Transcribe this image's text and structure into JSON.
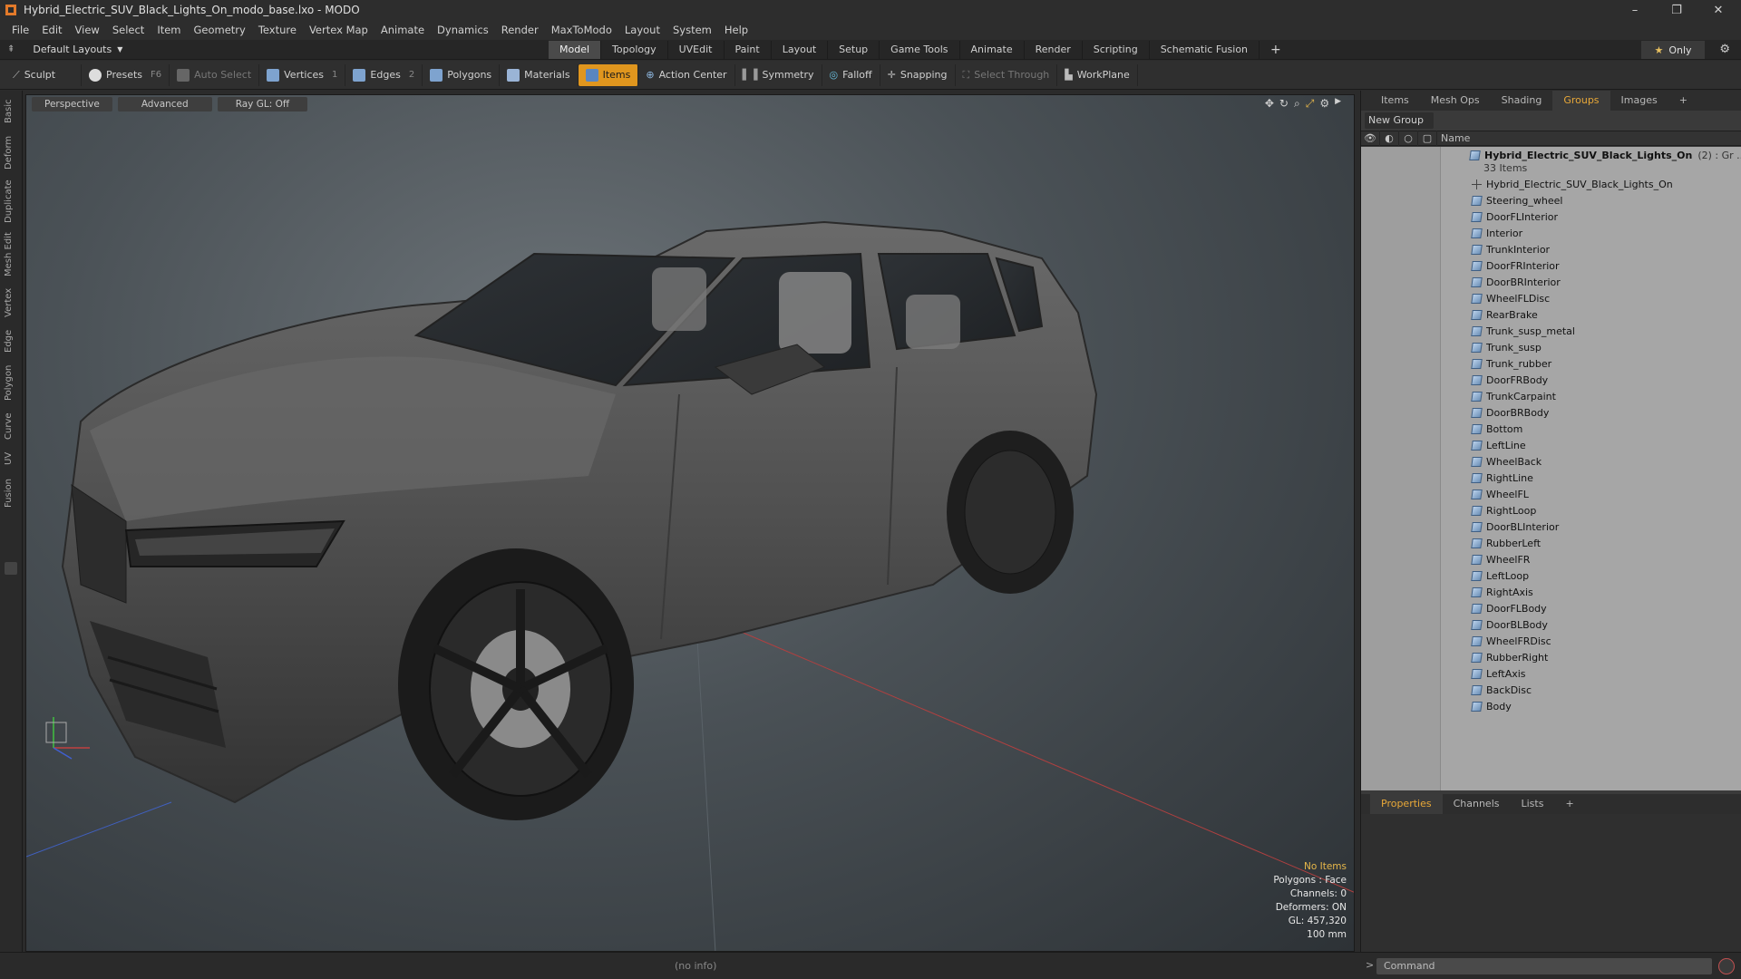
{
  "window": {
    "title": "Hybrid_Electric_SUV_Black_Lights_On_modo_base.lxo - MODO",
    "minimize": "–",
    "restore": "❐",
    "close": "✕"
  },
  "menu": [
    "File",
    "Edit",
    "View",
    "Select",
    "Item",
    "Geometry",
    "Texture",
    "Vertex Map",
    "Animate",
    "Dynamics",
    "Render",
    "MaxToModo",
    "Layout",
    "System",
    "Help"
  ],
  "layout": {
    "selector": "Default Layouts",
    "tabs": [
      "Model",
      "Topology",
      "UVEdit",
      "Paint",
      "Layout",
      "Setup",
      "Game Tools",
      "Animate",
      "Render",
      "Scripting",
      "Schematic Fusion"
    ],
    "active_tab": "Model",
    "add": "+",
    "only": "Only"
  },
  "toolbar": {
    "sculpt": "Sculpt",
    "presets": "Presets",
    "presets_key": "F6",
    "auto_select": "Auto Select",
    "vertices": "Vertices",
    "vertices_key": "1",
    "edges": "Edges",
    "edges_key": "2",
    "polygons": "Polygons",
    "materials": "Materials",
    "items": "Items",
    "action_center": "Action Center",
    "symmetry": "Symmetry",
    "falloff": "Falloff",
    "snapping": "Snapping",
    "select_through": "Select Through",
    "workplane": "WorkPlane"
  },
  "left_tabs": [
    "Basic",
    "Deform",
    "Duplicate",
    "Mesh Edit",
    "Vertex",
    "Edge",
    "Polygon",
    "Curve",
    "UV",
    "Fusion"
  ],
  "viewport": {
    "view": "Perspective",
    "shading": "Advanced",
    "raygl": "Ray GL: Off",
    "stats": {
      "no_items": "No Items",
      "polygons": "Polygons : Face",
      "channels": "Channels: 0",
      "deformers": "Deformers: ON",
      "gl": "GL: 457,320",
      "scale": "100 mm"
    }
  },
  "panel": {
    "tabs": [
      "Items",
      "Mesh Ops",
      "Shading",
      "Groups",
      "Images"
    ],
    "active_tab": "Groups",
    "new_group": "New Group",
    "column_name": "Name",
    "group_name": "Hybrid_Electric_SUV_Black_Lights_On",
    "group_suffix": "(2) : Gr ...",
    "item_count": "33 Items",
    "items": [
      "Hybrid_Electric_SUV_Black_Lights_On",
      "Steering_wheel",
      "DoorFLInterior",
      "Interior",
      "TrunkInterior",
      "DoorFRInterior",
      "DoorBRInterior",
      "WheelFLDisc",
      "RearBrake",
      "Trunk_susp_metal",
      "Trunk_susp",
      "Trunk_rubber",
      "DoorFRBody",
      "TrunkCarpaint",
      "DoorBRBody",
      "Bottom",
      "LeftLine",
      "WheelBack",
      "RightLine",
      "WheelFL",
      "RightLoop",
      "DoorBLInterior",
      "RubberLeft",
      "WheelFR",
      "LeftLoop",
      "RightAxis",
      "DoorFLBody",
      "DoorBLBody",
      "WheelFRDisc",
      "RubberRight",
      "LeftAxis",
      "BackDisc",
      "Body"
    ]
  },
  "props": {
    "tabs": [
      "Properties",
      "Channels",
      "Lists"
    ],
    "active_tab": "Properties"
  },
  "status": {
    "info": "(no info)",
    "command_placeholder": "Command"
  }
}
